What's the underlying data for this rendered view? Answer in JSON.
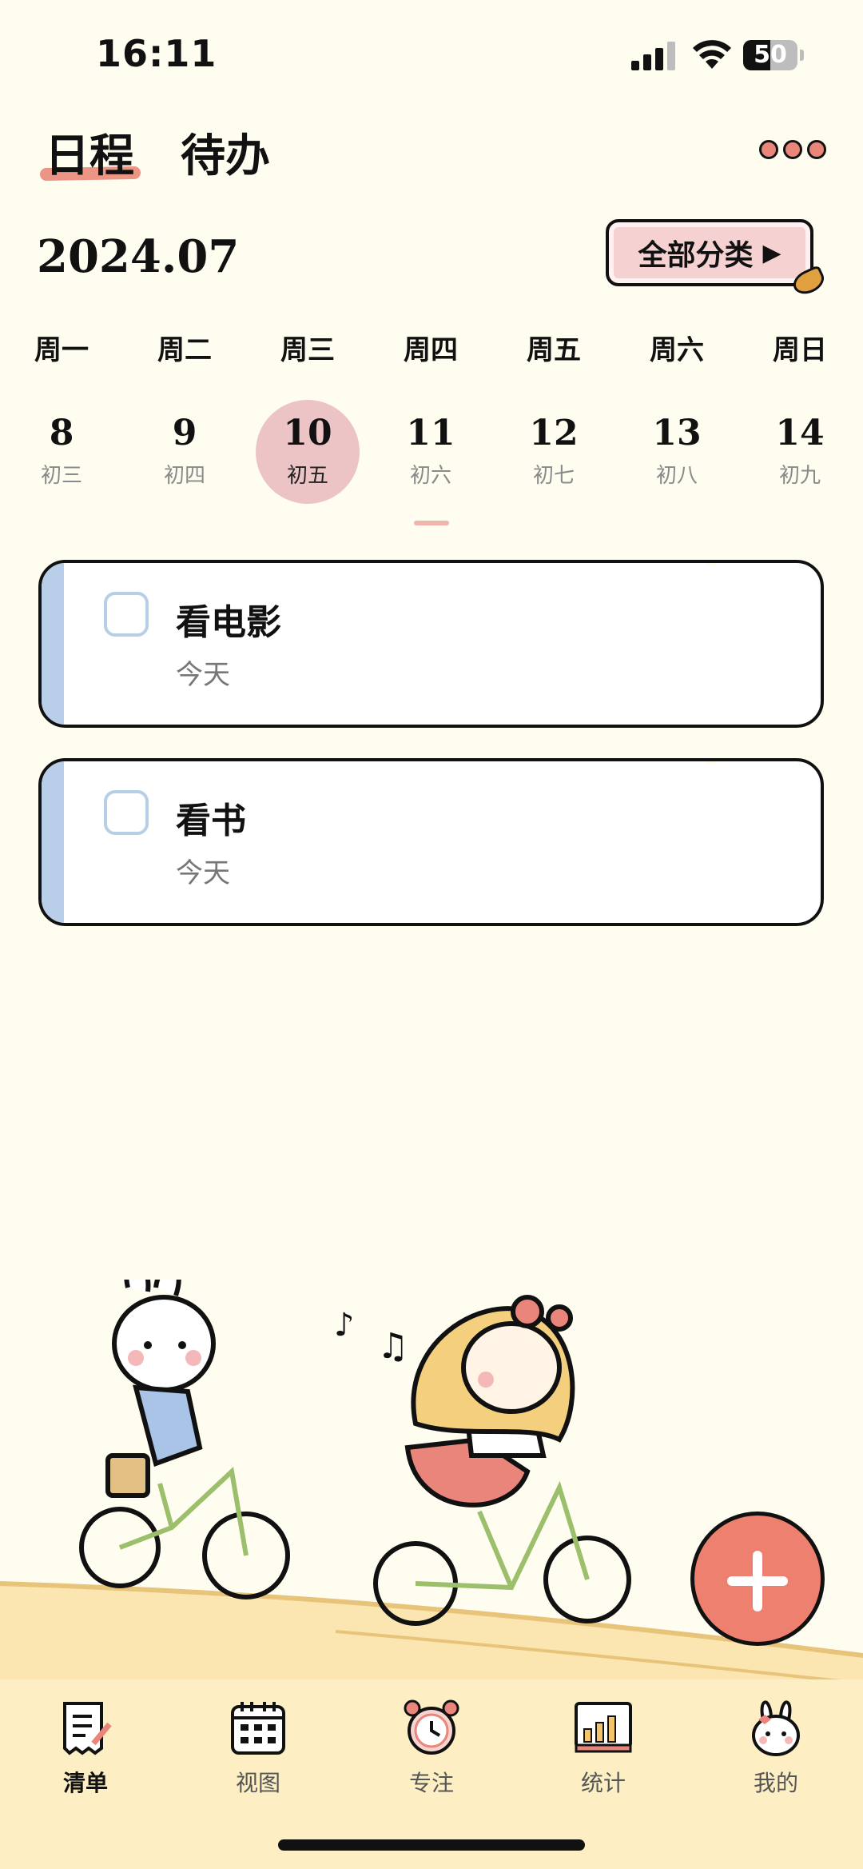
{
  "status": {
    "time": "16:11",
    "battery": "50",
    "battery_level": 0.5
  },
  "tabs": [
    {
      "label": "日程",
      "active": true
    },
    {
      "label": "待办",
      "active": false
    }
  ],
  "more_icon": "more-dots-icon",
  "header": {
    "month": "2024.07",
    "category_label": "全部分类",
    "category_arrow": "▶"
  },
  "weekdays": [
    "周一",
    "周二",
    "周三",
    "周四",
    "周五",
    "周六",
    "周日"
  ],
  "days": [
    {
      "num": "8",
      "lunar": "初三"
    },
    {
      "num": "9",
      "lunar": "初四"
    },
    {
      "num": "10",
      "lunar": "初五",
      "selected": true
    },
    {
      "num": "11",
      "lunar": "初六"
    },
    {
      "num": "12",
      "lunar": "初七"
    },
    {
      "num": "13",
      "lunar": "初八"
    },
    {
      "num": "14",
      "lunar": "初九"
    }
  ],
  "tasks": [
    {
      "title": "看电影",
      "date": "今天",
      "done": false
    },
    {
      "title": "看书",
      "date": "今天",
      "done": false
    }
  ],
  "colors": {
    "accent": "#ee8070",
    "selected_day": "#ecc4c6",
    "task_bar": "#b9cfe9",
    "background": "#fffcf0"
  },
  "nav": [
    {
      "label": "清单",
      "icon": "list-icon",
      "active": true
    },
    {
      "label": "视图",
      "icon": "calendar-icon",
      "active": false
    },
    {
      "label": "专注",
      "icon": "alarm-clock-icon",
      "active": false
    },
    {
      "label": "统计",
      "icon": "bar-chart-icon",
      "active": false
    },
    {
      "label": "我的",
      "icon": "bunny-profile-icon",
      "active": false
    }
  ]
}
